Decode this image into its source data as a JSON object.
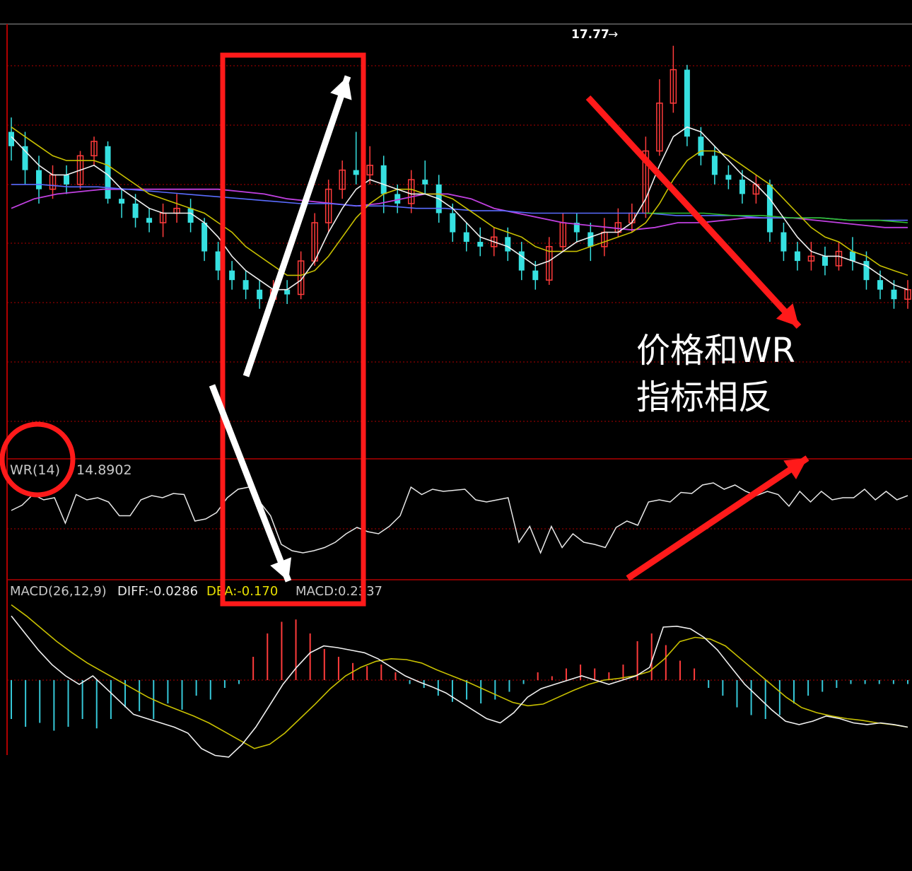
{
  "chart_data": {
    "type": "candlestick",
    "peak_label": "17.77",
    "wr": {
      "label": "WR(14)",
      "value": "14.8902",
      "values": [
        60,
        65,
        75,
        70,
        72,
        48,
        75,
        70,
        72,
        68,
        55,
        55,
        70,
        74,
        72,
        76,
        75,
        50,
        52,
        58,
        72,
        80,
        82,
        68,
        55,
        28,
        22,
        20,
        22,
        25,
        30,
        38,
        44,
        40,
        38,
        45,
        55,
        82,
        75,
        80,
        78,
        79,
        80,
        70,
        68,
        70,
        72,
        30,
        45,
        20,
        45,
        25,
        38,
        30,
        28,
        25,
        44,
        50,
        46,
        68,
        70,
        68,
        77,
        76,
        84,
        86,
        80,
        84,
        78,
        74,
        78,
        75,
        64,
        78,
        68,
        78,
        70,
        72,
        72,
        80,
        70,
        78,
        70,
        74
      ]
    },
    "macd": {
      "label": "MACD(26,12,9)",
      "diff_label": "DIFF:-0.0286",
      "dea_label": "DEA:-0.170",
      "macd_label": "MACD:0.2337",
      "diff": [
        0.75,
        0.55,
        0.35,
        0.18,
        0.05,
        -0.05,
        0.05,
        -0.1,
        -0.25,
        -0.4,
        -0.45,
        -0.5,
        -0.55,
        -0.62,
        -0.8,
        -0.88,
        -0.9,
        -0.75,
        -0.55,
        -0.3,
        -0.05,
        0.15,
        0.32,
        0.4,
        0.38,
        0.35,
        0.32,
        0.25,
        0.15,
        0.05,
        -0.02,
        -0.08,
        -0.15,
        -0.25,
        -0.35,
        -0.45,
        -0.5,
        -0.38,
        -0.2,
        -0.1,
        -0.05,
        0.0,
        0.05,
        0.0,
        -0.05,
        0.0,
        0.05,
        0.15,
        0.62,
        0.63,
        0.6,
        0.5,
        0.35,
        0.15,
        -0.05,
        -0.2,
        -0.35,
        -0.48,
        -0.52,
        -0.48,
        -0.42,
        -0.45,
        -0.5,
        -0.52,
        -0.5,
        -0.52,
        -0.55
      ],
      "dea": [
        0.88,
        0.75,
        0.6,
        0.45,
        0.32,
        0.2,
        0.1,
        0.0,
        -0.1,
        -0.2,
        -0.28,
        -0.35,
        -0.42,
        -0.5,
        -0.6,
        -0.7,
        -0.8,
        -0.75,
        -0.62,
        -0.45,
        -0.28,
        -0.1,
        0.05,
        0.15,
        0.22,
        0.25,
        0.24,
        0.2,
        0.12,
        0.05,
        -0.02,
        -0.1,
        -0.18,
        -0.26,
        -0.3,
        -0.28,
        -0.2,
        -0.12,
        -0.05,
        0.0,
        0.02,
        0.05,
        0.1,
        0.25,
        0.45,
        0.5,
        0.48,
        0.4,
        0.25,
        0.1,
        -0.05,
        -0.2,
        -0.32,
        -0.38,
        -0.42,
        -0.45,
        -0.47,
        -0.5,
        -0.52,
        -0.55
      ],
      "hist": [
        -0.5,
        -0.6,
        -0.55,
        -0.65,
        -0.6,
        -0.5,
        -0.62,
        -0.5,
        -0.35,
        -0.4,
        -0.5,
        -0.3,
        -0.38,
        -0.2,
        -0.25,
        -0.1,
        -0.05,
        0.3,
        0.6,
        0.75,
        0.78,
        0.6,
        0.4,
        0.3,
        0.22,
        0.18,
        0.2,
        0.1,
        -0.05,
        -0.1,
        -0.2,
        -0.28,
        -0.25,
        -0.3,
        -0.25,
        -0.15,
        -0.05,
        0.1,
        0.05,
        0.15,
        0.2,
        0.15,
        0.1,
        0.2,
        0.5,
        0.6,
        0.45,
        0.25,
        0.15,
        -0.1,
        -0.2,
        -0.35,
        -0.45,
        -0.5,
        -0.45,
        -0.3,
        -0.2,
        -0.15,
        -0.1,
        -0.05,
        -0.05,
        -0.05,
        -0.05,
        -0.05
      ]
    },
    "candles": [
      {
        "o": 15.9,
        "c": 15.6,
        "h": 16.2,
        "l": 15.3
      },
      {
        "o": 15.6,
        "c": 15.1,
        "h": 15.9,
        "l": 14.8
      },
      {
        "o": 15.1,
        "c": 14.7,
        "h": 15.4,
        "l": 14.4
      },
      {
        "o": 14.7,
        "c": 15.0,
        "h": 15.2,
        "l": 14.5
      },
      {
        "o": 15.0,
        "c": 14.8,
        "h": 15.2,
        "l": 14.6
      },
      {
        "o": 14.8,
        "c": 15.4,
        "h": 15.5,
        "l": 14.7
      },
      {
        "o": 15.4,
        "c": 15.7,
        "h": 15.8,
        "l": 15.2
      },
      {
        "o": 15.6,
        "c": 14.5,
        "h": 15.7,
        "l": 14.4
      },
      {
        "o": 14.5,
        "c": 14.4,
        "h": 14.7,
        "l": 14.1
      },
      {
        "o": 14.4,
        "c": 14.1,
        "h": 14.6,
        "l": 13.9
      },
      {
        "o": 14.1,
        "c": 14.0,
        "h": 14.3,
        "l": 13.8
      },
      {
        "o": 14.0,
        "c": 14.2,
        "h": 14.4,
        "l": 13.7
      },
      {
        "o": 14.2,
        "c": 14.3,
        "h": 14.6,
        "l": 14.0
      },
      {
        "o": 14.3,
        "c": 14.0,
        "h": 14.5,
        "l": 13.8
      },
      {
        "o": 14.0,
        "c": 13.4,
        "h": 14.1,
        "l": 13.2
      },
      {
        "o": 13.4,
        "c": 13.0,
        "h": 13.6,
        "l": 12.8
      },
      {
        "o": 13.0,
        "c": 12.8,
        "h": 13.2,
        "l": 12.6
      },
      {
        "o": 12.8,
        "c": 12.6,
        "h": 13.0,
        "l": 12.4
      },
      {
        "o": 12.6,
        "c": 12.4,
        "h": 12.8,
        "l": 12.2
      },
      {
        "o": 12.4,
        "c": 12.6,
        "h": 12.8,
        "l": 12.3
      },
      {
        "o": 12.6,
        "c": 12.5,
        "h": 12.8,
        "l": 12.3
      },
      {
        "o": 12.5,
        "c": 13.2,
        "h": 13.4,
        "l": 12.4
      },
      {
        "o": 13.2,
        "c": 14.0,
        "h": 14.2,
        "l": 13.1
      },
      {
        "o": 14.0,
        "c": 14.7,
        "h": 14.9,
        "l": 13.8
      },
      {
        "o": 14.7,
        "c": 15.1,
        "h": 15.3,
        "l": 14.5
      },
      {
        "o": 15.1,
        "c": 15.0,
        "h": 15.9,
        "l": 14.8
      },
      {
        "o": 15.0,
        "c": 15.2,
        "h": 15.6,
        "l": 14.8
      },
      {
        "o": 15.2,
        "c": 14.6,
        "h": 15.4,
        "l": 14.2
      },
      {
        "o": 14.6,
        "c": 14.4,
        "h": 14.8,
        "l": 14.2
      },
      {
        "o": 14.4,
        "c": 14.9,
        "h": 15.1,
        "l": 14.2
      },
      {
        "o": 14.9,
        "c": 14.8,
        "h": 15.3,
        "l": 14.6
      },
      {
        "o": 14.8,
        "c": 14.2,
        "h": 15.0,
        "l": 14.0
      },
      {
        "o": 14.2,
        "c": 13.8,
        "h": 14.4,
        "l": 13.6
      },
      {
        "o": 13.8,
        "c": 13.6,
        "h": 14.0,
        "l": 13.4
      },
      {
        "o": 13.6,
        "c": 13.5,
        "h": 13.9,
        "l": 13.3
      },
      {
        "o": 13.5,
        "c": 13.7,
        "h": 13.9,
        "l": 13.3
      },
      {
        "o": 13.7,
        "c": 13.4,
        "h": 13.9,
        "l": 13.2
      },
      {
        "o": 13.4,
        "c": 13.0,
        "h": 13.6,
        "l": 12.8
      },
      {
        "o": 13.0,
        "c": 12.8,
        "h": 13.2,
        "l": 12.6
      },
      {
        "o": 12.8,
        "c": 13.5,
        "h": 13.7,
        "l": 12.7
      },
      {
        "o": 13.5,
        "c": 14.0,
        "h": 14.2,
        "l": 13.4
      },
      {
        "o": 14.0,
        "c": 13.8,
        "h": 14.2,
        "l": 13.6
      },
      {
        "o": 13.8,
        "c": 13.5,
        "h": 14.0,
        "l": 13.2
      },
      {
        "o": 13.5,
        "c": 13.8,
        "h": 14.1,
        "l": 13.3
      },
      {
        "o": 13.8,
        "c": 14.0,
        "h": 14.3,
        "l": 13.7
      },
      {
        "o": 14.0,
        "c": 14.2,
        "h": 14.4,
        "l": 13.8
      },
      {
        "o": 14.2,
        "c": 15.5,
        "h": 15.8,
        "l": 14.1
      },
      {
        "o": 15.5,
        "c": 16.5,
        "h": 17.0,
        "l": 15.4
      },
      {
        "o": 16.5,
        "c": 17.2,
        "h": 17.7,
        "l": 16.3
      },
      {
        "o": 17.2,
        "c": 15.8,
        "h": 17.3,
        "l": 15.6
      },
      {
        "o": 15.8,
        "c": 15.4,
        "h": 16.0,
        "l": 15.2
      },
      {
        "o": 15.4,
        "c": 15.0,
        "h": 15.6,
        "l": 14.8
      },
      {
        "o": 15.0,
        "c": 14.9,
        "h": 15.2,
        "l": 14.7
      },
      {
        "o": 14.9,
        "c": 14.6,
        "h": 15.1,
        "l": 14.4
      },
      {
        "o": 14.6,
        "c": 14.8,
        "h": 15.0,
        "l": 14.4
      },
      {
        "o": 14.8,
        "c": 13.8,
        "h": 14.9,
        "l": 13.6
      },
      {
        "o": 13.8,
        "c": 13.4,
        "h": 14.0,
        "l": 13.2
      },
      {
        "o": 13.4,
        "c": 13.2,
        "h": 13.6,
        "l": 13.0
      },
      {
        "o": 13.2,
        "c": 13.3,
        "h": 13.6,
        "l": 13.0
      },
      {
        "o": 13.3,
        "c": 13.1,
        "h": 13.5,
        "l": 12.9
      },
      {
        "o": 13.1,
        "c": 13.4,
        "h": 13.6,
        "l": 13.0
      },
      {
        "o": 13.4,
        "c": 13.2,
        "h": 13.7,
        "l": 13.0
      },
      {
        "o": 13.2,
        "c": 12.8,
        "h": 13.4,
        "l": 12.6
      },
      {
        "o": 12.8,
        "c": 12.6,
        "h": 13.0,
        "l": 12.4
      },
      {
        "o": 12.6,
        "c": 12.4,
        "h": 12.8,
        "l": 12.2
      },
      {
        "o": 12.4,
        "c": 12.6,
        "h": 12.8,
        "l": 12.2
      }
    ],
    "ma_white": [
      15.8,
      15.5,
      15.2,
      15.0,
      15.0,
      15.1,
      15.2,
      15.0,
      14.7,
      14.5,
      14.3,
      14.2,
      14.2,
      14.2,
      14.0,
      13.7,
      13.3,
      13.0,
      12.8,
      12.6,
      12.6,
      12.8,
      13.2,
      13.8,
      14.3,
      14.7,
      14.9,
      14.8,
      14.7,
      14.6,
      14.6,
      14.5,
      14.3,
      14.0,
      13.7,
      13.6,
      13.5,
      13.3,
      13.1,
      13.2,
      13.4,
      13.6,
      13.7,
      13.8,
      13.8,
      14.0,
      14.5,
      15.2,
      15.8,
      16.0,
      15.9,
      15.6,
      15.3,
      15.0,
      14.8,
      14.5,
      14.1,
      13.7,
      13.4,
      13.3,
      13.3,
      13.2,
      13.1,
      12.9,
      12.7,
      12.6
    ],
    "ma_yellow": [
      16.0,
      15.8,
      15.6,
      15.4,
      15.3,
      15.3,
      15.3,
      15.2,
      15.0,
      14.8,
      14.6,
      14.5,
      14.4,
      14.3,
      14.2,
      14.0,
      13.8,
      13.5,
      13.3,
      13.1,
      12.9,
      12.9,
      13.0,
      13.3,
      13.7,
      14.1,
      14.4,
      14.6,
      14.7,
      14.7,
      14.6,
      14.6,
      14.5,
      14.3,
      14.1,
      13.9,
      13.8,
      13.7,
      13.5,
      13.4,
      13.4,
      13.4,
      13.5,
      13.6,
      13.7,
      13.8,
      14.0,
      14.4,
      14.9,
      15.3,
      15.5,
      15.5,
      15.4,
      15.2,
      15.0,
      14.8,
      14.5,
      14.2,
      13.9,
      13.7,
      13.6,
      13.4,
      13.3,
      13.1,
      13.0,
      12.9
    ],
    "ma_purple": [
      14.3,
      14.5,
      14.6,
      14.65,
      14.7,
      14.7,
      14.7,
      14.7,
      14.7,
      14.7,
      14.65,
      14.6,
      14.5,
      14.45,
      14.4,
      14.35,
      14.4,
      14.5,
      14.6,
      14.6,
      14.5,
      14.3,
      14.2,
      14.1,
      14.0,
      13.95,
      13.9,
      13.85,
      13.9,
      14.0,
      14.0,
      14.05,
      14.1,
      14.1,
      14.1,
      14.05,
      14.0,
      13.95,
      13.9,
      13.9
    ],
    "ma_blue": [
      14.8,
      14.8,
      14.75,
      14.75,
      14.7,
      14.65,
      14.6,
      14.55,
      14.5,
      14.45,
      14.4,
      14.4,
      14.35,
      14.35,
      14.3,
      14.3,
      14.25,
      14.25,
      14.2,
      14.2,
      14.2,
      14.2,
      14.2,
      14.15,
      14.15,
      14.15,
      14.1,
      14.1,
      14.1,
      14.05,
      14.05,
      14.05
    ],
    "ma_green": [
      14.2,
      14.2,
      14.2,
      14.15,
      14.15,
      14.1,
      14.1,
      14.05,
      14.05,
      14.0
    ]
  },
  "annotation": {
    "line1": "价格和WR",
    "line2": "指标相反"
  }
}
